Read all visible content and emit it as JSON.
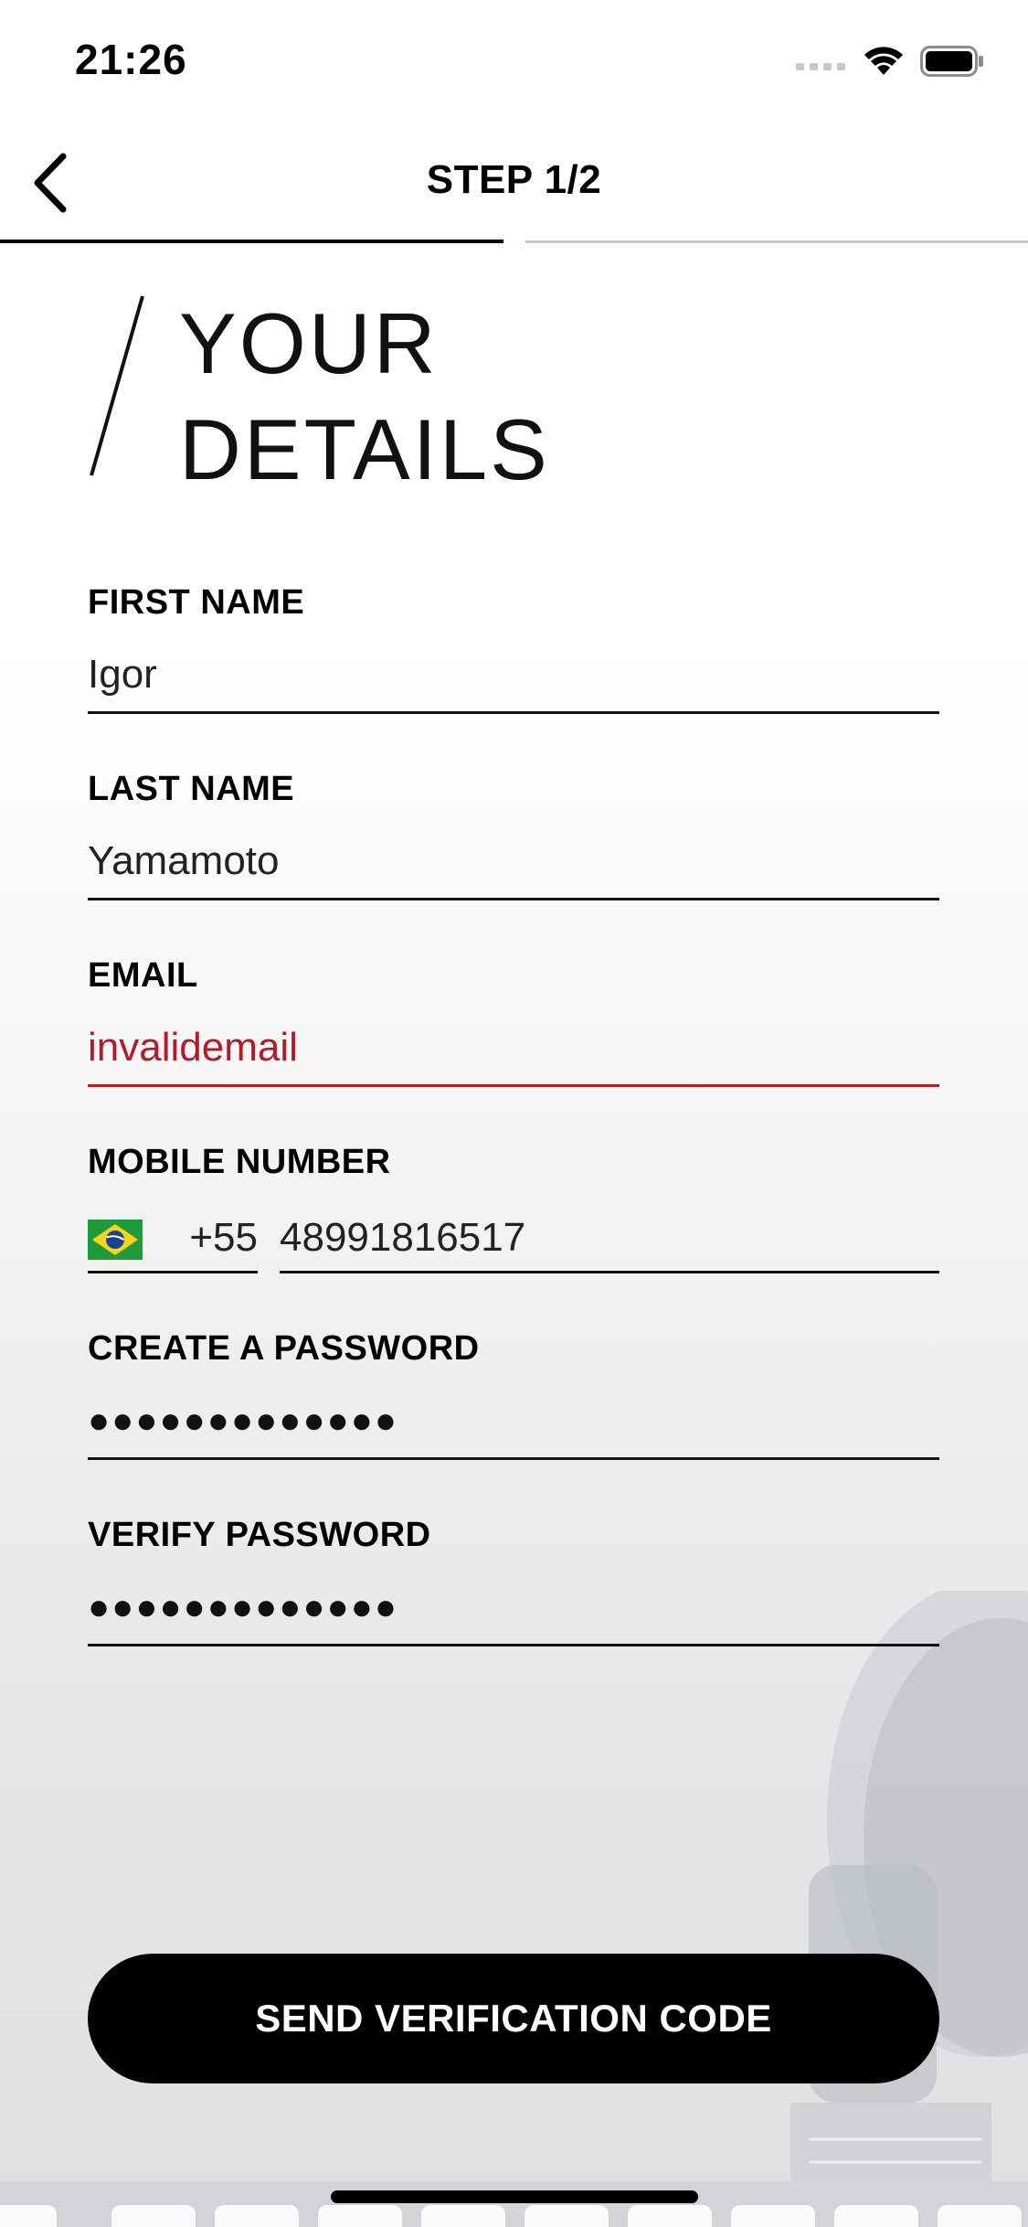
{
  "status_bar": {
    "time": "21:26",
    "icons": [
      "signal-icon",
      "wifi-icon",
      "battery-icon"
    ]
  },
  "nav": {
    "back_icon": "chevron-left-icon",
    "title": "STEP 1/2",
    "progress": 0.5
  },
  "heading": {
    "line1": "YOUR",
    "line2": "DETAILS"
  },
  "form": {
    "first_name": {
      "label": "FIRST NAME",
      "value": "Igor"
    },
    "last_name": {
      "label": "LAST NAME",
      "value": "Yamamoto"
    },
    "email": {
      "label": "EMAIL",
      "value": "invalidemail",
      "state": "error"
    },
    "mobile": {
      "label": "MOBILE NUMBER",
      "country_flag": "brazil-flag-icon",
      "dial_code": "+55",
      "value": "48991816517"
    },
    "password": {
      "label": "CREATE A PASSWORD",
      "value": "●●●●●●●●●●●●●"
    },
    "verify_password": {
      "label": "VERIFY PASSWORD",
      "value": "●●●●●●●●●●●●●"
    }
  },
  "actions": {
    "send_code_label": "SEND VERIFICATION CODE"
  },
  "colors": {
    "accent": "#000000",
    "error": "#b21c2a",
    "progress_inactive": "#c9c9c9",
    "background": "#ffffff"
  }
}
